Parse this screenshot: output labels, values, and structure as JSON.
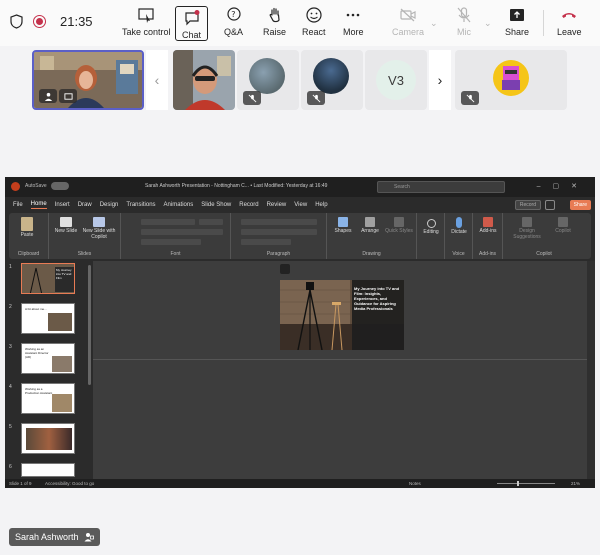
{
  "meeting": {
    "time": "21:35",
    "controls": [
      {
        "id": "take-control",
        "label": "Take control"
      },
      {
        "id": "chat",
        "label": "Chat"
      },
      {
        "id": "qa",
        "label": "Q&A"
      },
      {
        "id": "raise",
        "label": "Raise"
      },
      {
        "id": "react",
        "label": "React"
      },
      {
        "id": "more",
        "label": "More"
      },
      {
        "id": "camera",
        "label": "Camera"
      },
      {
        "id": "mic",
        "label": "Mic"
      },
      {
        "id": "share",
        "label": "Share"
      },
      {
        "id": "leave",
        "label": "Leave"
      }
    ]
  },
  "participants": {
    "v3_initials": "V3"
  },
  "ppt": {
    "autosave": "AutoSave",
    "doc_title": "Sarah Ashworth Presentation - Nottingham C... • Last Modified: Yesterday at 16:49",
    "search_placeholder": "Search",
    "tabs": [
      "File",
      "Home",
      "Insert",
      "Draw",
      "Design",
      "Transitions",
      "Animations",
      "Slide Show",
      "Record",
      "Review",
      "View",
      "Help"
    ],
    "record_label": "Record",
    "share_label": "Share",
    "ribbon": {
      "paste": "Paste",
      "clipboard": "Clipboard",
      "new_slide": "New Slide",
      "new_slide_copilot": "New Slide with Copilot",
      "slides": "Slides",
      "font": "Font",
      "paragraph": "Paragraph",
      "shapes": "Shapes",
      "arrange": "Arrange",
      "quick_styles": "Quick Styles",
      "drawing": "Drawing",
      "editing": "Editing",
      "dictate": "Dictate",
      "voice": "Voice",
      "addins": "Add-ins",
      "addins_group": "Add-ins",
      "designer": "Design Suggestions",
      "copilot": "Copilot",
      "copilot_group": "Copilot"
    },
    "thumbnails": [
      {
        "num": "1",
        "title": "My Journey into TV and Film"
      },
      {
        "num": "2",
        "title": "A bit about me..."
      },
      {
        "num": "3",
        "title": "Working as an Assistant Director (AD)"
      },
      {
        "num": "4",
        "title": "Working as a Production Assistant"
      },
      {
        "num": "5",
        "title": ""
      },
      {
        "num": "6",
        "title": ""
      }
    ],
    "slide_title": "My Journey into TV and Film: Insights, Experiences, and Guidance for Aspiring Media Professionals",
    "status": {
      "slide_count": "Slide 1 of 9",
      "accessibility": "Accessibility: Good to go",
      "notes": "Notes",
      "zoom": "21%"
    }
  },
  "presenter": {
    "name": "Sarah Ashworth"
  },
  "colors": {
    "accent": "#5b5fc7",
    "leave": "#c4314b",
    "ppt_orange": "#e87b54"
  }
}
